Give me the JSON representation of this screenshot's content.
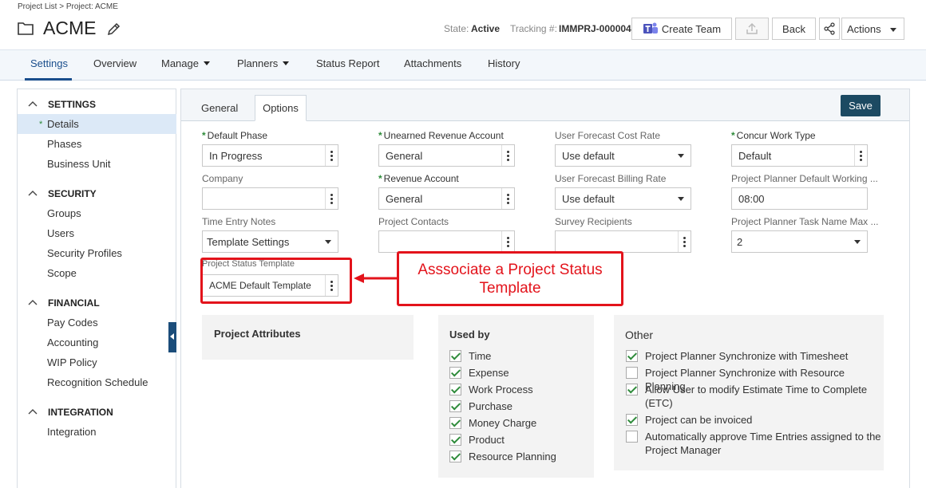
{
  "header": {
    "breadcrumb": "Project List > Project: ACME",
    "title": "ACME",
    "state_label": "State:",
    "state_value": "Active",
    "tracking_label": "Tracking #:",
    "tracking_value": "IMMPRJ-000004",
    "create_team_label": "Create Team",
    "back_label": "Back",
    "actions_label": "Actions",
    "icons": [
      "folder-icon",
      "pencil-icon",
      "teams-icon",
      "upload-icon",
      "share-icon"
    ]
  },
  "nav": {
    "tabs": [
      {
        "label": "Settings",
        "active": true
      },
      {
        "label": "Overview"
      },
      {
        "label": "Manage",
        "dropdown": true
      },
      {
        "label": "Planners",
        "dropdown": true
      },
      {
        "label": "Status Report"
      },
      {
        "label": "Attachments"
      },
      {
        "label": "History"
      }
    ]
  },
  "sidebar": {
    "sections": [
      {
        "title": "SETTINGS",
        "items": [
          "Details",
          "Phases",
          "Business Unit"
        ]
      },
      {
        "title": "SECURITY",
        "items": [
          "Groups",
          "Users",
          "Security Profiles",
          "Scope"
        ]
      },
      {
        "title": "FINANCIAL",
        "items": [
          "Pay Codes",
          "Accounting",
          "WIP Policy",
          "Recognition Schedule"
        ]
      },
      {
        "title": "INTEGRATION",
        "items": [
          "Integration"
        ]
      }
    ],
    "active_item": "Details",
    "active_marker": "*"
  },
  "tabs": {
    "general": "General",
    "options": "Options",
    "save_label": "Save"
  },
  "form": {
    "default_phase": {
      "label": "Default Phase",
      "value": "In Progress"
    },
    "unearned_revenue": {
      "label": "Unearned Revenue Account",
      "value": "General"
    },
    "forecast_cost_rate": {
      "label": "User Forecast Cost Rate",
      "value": "Use default"
    },
    "concur_work_type": {
      "label": "Concur Work Type",
      "value": "Default"
    },
    "company": {
      "label": "Company",
      "value": ""
    },
    "revenue_account": {
      "label": "Revenue Account",
      "value": "General"
    },
    "forecast_billing_rate": {
      "label": "User Forecast Billing Rate",
      "value": "Use default"
    },
    "planner_working": {
      "label": "Project Planner Default Working ...",
      "value": "08:00"
    },
    "time_entry_notes": {
      "label": "Time Entry Notes",
      "value": "Template Settings"
    },
    "project_contacts": {
      "label": "Project Contacts",
      "value": ""
    },
    "survey_recipients": {
      "label": "Survey Recipients",
      "value": ""
    },
    "planner_task_name": {
      "label": "Project Planner Task Name Max ...",
      "value": "2"
    },
    "status_template": {
      "label": "Project Status Template",
      "value": "ACME Default Template"
    },
    "required_marker": "*"
  },
  "annotation": {
    "text": "Asssociate a Project Status Template",
    "color": "#e3131b"
  },
  "panels": {
    "attributes": {
      "title": "Project Attributes"
    },
    "used_by": {
      "title": "Used by",
      "items": [
        {
          "label": "Time",
          "checked": true
        },
        {
          "label": "Expense",
          "checked": true
        },
        {
          "label": "Work Process",
          "checked": true
        },
        {
          "label": "Purchase",
          "checked": true
        },
        {
          "label": "Money Charge",
          "checked": true
        },
        {
          "label": "Product",
          "checked": true
        },
        {
          "label": "Resource Planning",
          "checked": true
        }
      ]
    },
    "other": {
      "title": "Other",
      "items": [
        {
          "label": "Project Planner Synchronize with Timesheet",
          "checked": true
        },
        {
          "label": "Project Planner Synchronize with Resource Planning",
          "checked": false
        },
        {
          "label": "Allow User to modify Estimate Time to Complete (ETC)",
          "checked": true
        },
        {
          "label": "Project can be invoiced",
          "checked": true
        },
        {
          "label": "Automatically approve Time Entries assigned to the Project Manager",
          "checked": false
        }
      ]
    }
  }
}
